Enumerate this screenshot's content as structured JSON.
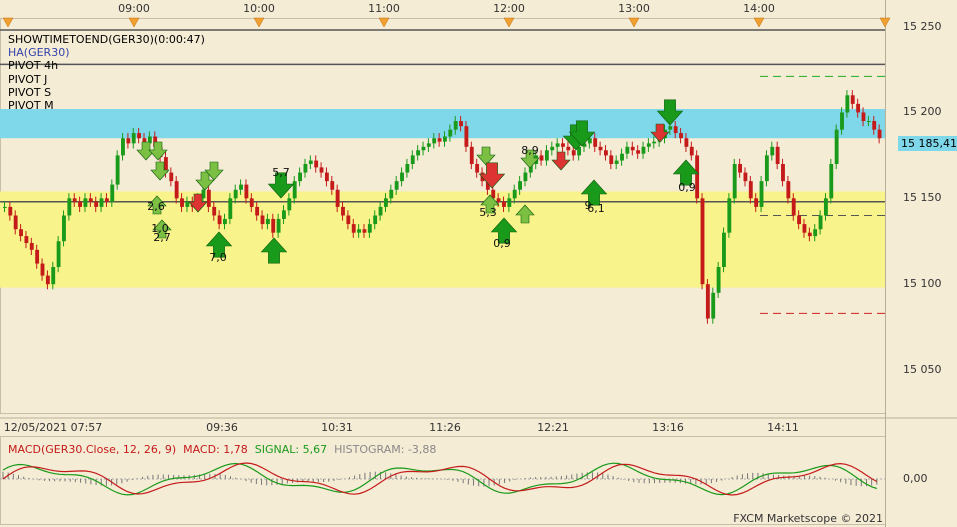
{
  "app": {
    "credit": "FXCM Marketscope © 2021"
  },
  "indicators": [
    {
      "label": "SHOWTIMETOEND(GER30)(0:00:47)",
      "color": "#000000"
    },
    {
      "label": "HA(GER30)",
      "color": "#3344aa"
    },
    {
      "label": "PIVOT 4h",
      "color": "#000000"
    },
    {
      "label": "PIVOT J",
      "color": "#000000"
    },
    {
      "label": "PIVOT S",
      "color": "#000000"
    },
    {
      "label": "PIVOT M",
      "color": "#000000"
    }
  ],
  "price_tag": "15 185,41",
  "macd": {
    "title": "MACD(GER30.Close, 12, 26, 9)",
    "macd_label": "MACD: 1,78",
    "signal_label": "SIGNAL: 5,67",
    "histogram_label": "HISTOGRAM: -3,88",
    "zero_label": "0,00"
  },
  "colors": {
    "background": "#f5ecd6",
    "bull": "#1a9a1a",
    "bear": "#c41a1a",
    "zone_blue": "#7fd8ea",
    "zone_yellow": "#f8f38a"
  },
  "chart_data": {
    "type": "candlestick",
    "symbol": "GER30",
    "date": "12/05/2021",
    "top_time_ticks": [
      "09:00",
      "10:00",
      "11:00",
      "12:00",
      "13:00",
      "14:00"
    ],
    "bottom_time_ticks": [
      "12/05/2021 07:57",
      "09:36",
      "10:31",
      "11:26",
      "12:21",
      "13:16",
      "14:11"
    ],
    "y_ticks": [
      "15 250",
      "15 200",
      "15 150",
      "15 100",
      "15 050"
    ],
    "ylim": [
      15025,
      15255
    ],
    "zones": [
      {
        "name": "upper",
        "from": 15185,
        "to": 15202,
        "color": "#7fd8ea"
      },
      {
        "name": "lower",
        "from": 15098,
        "to": 15154,
        "color": "#f8f38a"
      }
    ],
    "levels": [
      15248,
      15228,
      15148
    ],
    "dashed_levels": [
      {
        "value": 15221,
        "color": "#22aa22"
      },
      {
        "value": 15140,
        "color": "#555555"
      },
      {
        "value": 15083,
        "color": "#cc2222"
      }
    ],
    "signal_labels": [
      "2,6",
      "1,0",
      "2,7",
      "7,0",
      "5,7",
      "5,3",
      "0,9",
      "8,9",
      "9",
      "6,1",
      "0,9"
    ],
    "closes": [
      15145,
      15140,
      15132,
      15128,
      15124,
      15120,
      15112,
      15105,
      15100,
      15110,
      15125,
      15140,
      15150,
      15148,
      15145,
      15150,
      15148,
      15145,
      15150,
      15148,
      15158,
      15175,
      15185,
      15182,
      15188,
      15185,
      15182,
      15186,
      15180,
      15174,
      15165,
      15160,
      15150,
      15145,
      15148,
      15145,
      15150,
      15155,
      15145,
      15140,
      15135,
      15138,
      15150,
      15155,
      15158,
      15150,
      15145,
      15140,
      15135,
      15138,
      15130,
      15138,
      15143,
      15150,
      15160,
      15165,
      15170,
      15172,
      15168,
      15165,
      15160,
      15155,
      15145,
      15140,
      15135,
      15130,
      15132,
      15130,
      15135,
      15140,
      15145,
      15150,
      15155,
      15160,
      15165,
      15170,
      15175,
      15178,
      15180,
      15182,
      15185,
      15183,
      15186,
      15190,
      15195,
      15192,
      15180,
      15170,
      15165,
      15160,
      15155,
      15150,
      15148,
      15145,
      15150,
      15155,
      15160,
      15165,
      15170,
      15175,
      15172,
      15178,
      15180,
      15182,
      15180,
      15178,
      15175,
      15180,
      15182,
      15185,
      15180,
      15178,
      15175,
      15170,
      15172,
      15176,
      15180,
      15178,
      15176,
      15180,
      15182,
      15183,
      15185,
      15190,
      15192,
      15188,
      15185,
      15180,
      15175,
      15150,
      15100,
      15080,
      15095,
      15110,
      15130,
      15150,
      15170,
      15165,
      15160,
      15150,
      15145,
      15160,
      15175,
      15180,
      15170,
      15160,
      15150,
      15140,
      15135,
      15130,
      15128,
      15132,
      15140,
      15150,
      15170,
      15190,
      15200,
      15210,
      15205,
      15200,
      15195,
      15195,
      15190,
      15185
    ]
  }
}
